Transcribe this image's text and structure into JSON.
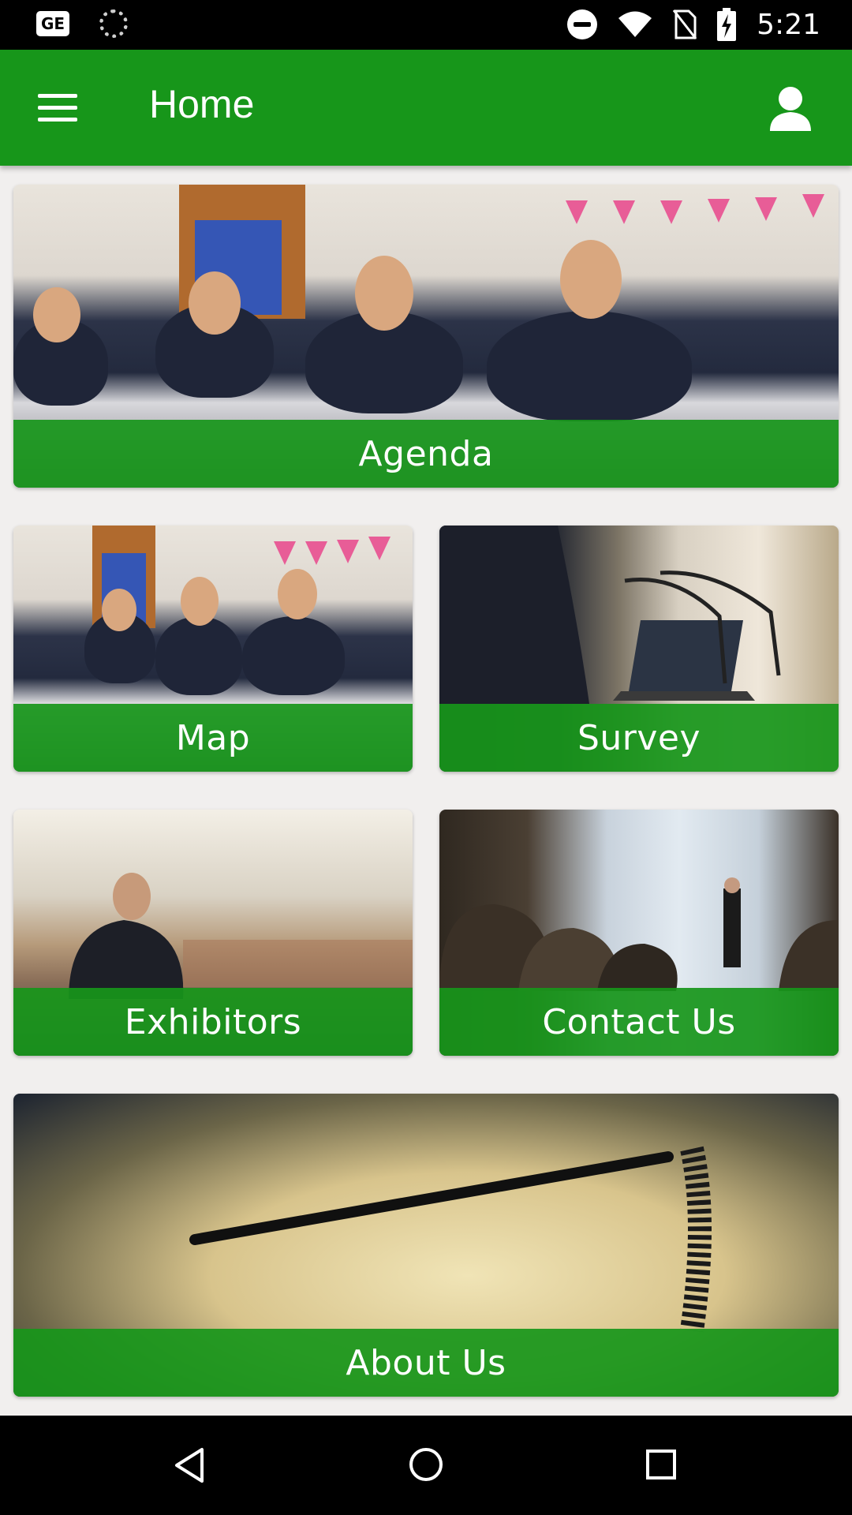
{
  "status_bar": {
    "time": "5:21",
    "left_icons": [
      "ge-icon",
      "sync-icon"
    ],
    "right_icons": [
      "dnd-icon",
      "wifi-icon",
      "no-sim-icon",
      "battery-charging-icon"
    ]
  },
  "app_bar": {
    "title": "Home",
    "color": "#17961a",
    "left_icon": "menu-icon",
    "right_icon": "profile-icon"
  },
  "tiles": [
    {
      "label": "Agenda"
    },
    {
      "label": "Map"
    },
    {
      "label": "Survey"
    },
    {
      "label": "Exhibitors"
    },
    {
      "label": "Contact Us"
    },
    {
      "label": "About Us"
    }
  ],
  "nav_bar": {
    "icons": [
      "back-icon",
      "home-icon",
      "recents-icon"
    ]
  }
}
